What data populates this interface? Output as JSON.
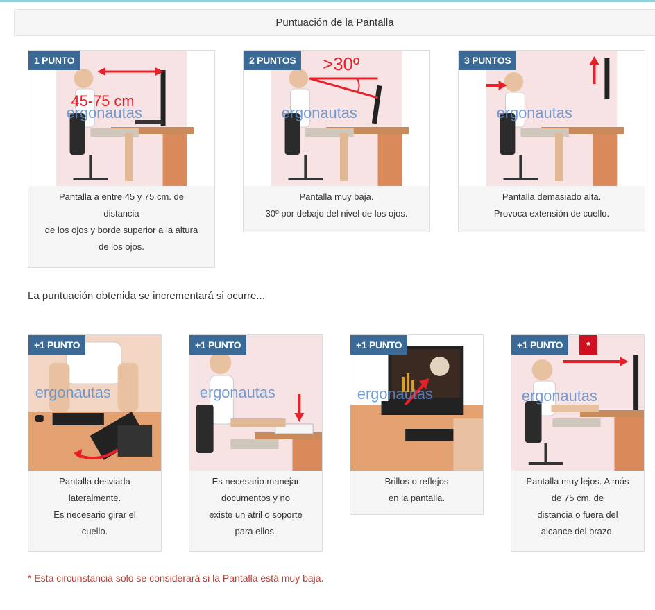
{
  "header": {
    "title": "Puntuación de la Pantalla"
  },
  "main_cards": [
    {
      "badge": "1 PUNTO",
      "overlay": "45-75 cm",
      "watermark": "ergonautas",
      "caption": [
        "Pantalla a entre 45 y 75 cm. de",
        "distancia",
        "de los ojos y borde superior a la altura",
        "de los ojos."
      ]
    },
    {
      "badge": "2 PUNTOS",
      "overlay": ">30º",
      "watermark": "ergonautas",
      "caption": [
        "Pantalla muy baja.",
        "30º por debajo del nivel de los ojos."
      ]
    },
    {
      "badge": "3 PUNTOS",
      "watermark": "ergonautas",
      "caption": [
        "Pantalla demasiado alta.",
        "Provoca extensión de cuello."
      ]
    }
  ],
  "section_text": "La puntuación obtenida se incrementará si ocurre...",
  "extra_cards": [
    {
      "badge": "+1 PUNTO",
      "watermark": "ergonautas",
      "caption": [
        "Pantalla desviada",
        "lateralmente.",
        "Es necesario girar el",
        "cuello."
      ]
    },
    {
      "badge": "+1 PUNTO",
      "watermark": "ergonautas",
      "caption": [
        "Es necesario manejar",
        "documentos y no",
        "existe un atril o soporte",
        "para ellos."
      ]
    },
    {
      "badge": "+1 PUNTO",
      "watermark": "ergonautas",
      "caption": [
        "Brillos o reflejos",
        "en la pantalla."
      ]
    },
    {
      "badge": "+1 PUNTO",
      "star": "*",
      "watermark": "ergonautas",
      "caption": [
        "Pantalla muy lejos. A más",
        "de 75 cm. de",
        "distancia o fuera del",
        "alcance del brazo."
      ]
    }
  ],
  "footnote": "* Esta circunstancia solo se considerará si la Pantalla está muy baja.",
  "colors": {
    "badge": "#3b6a96",
    "accent_red": "#e8202a",
    "star": "#d01020",
    "footnote": "#c0392b"
  }
}
